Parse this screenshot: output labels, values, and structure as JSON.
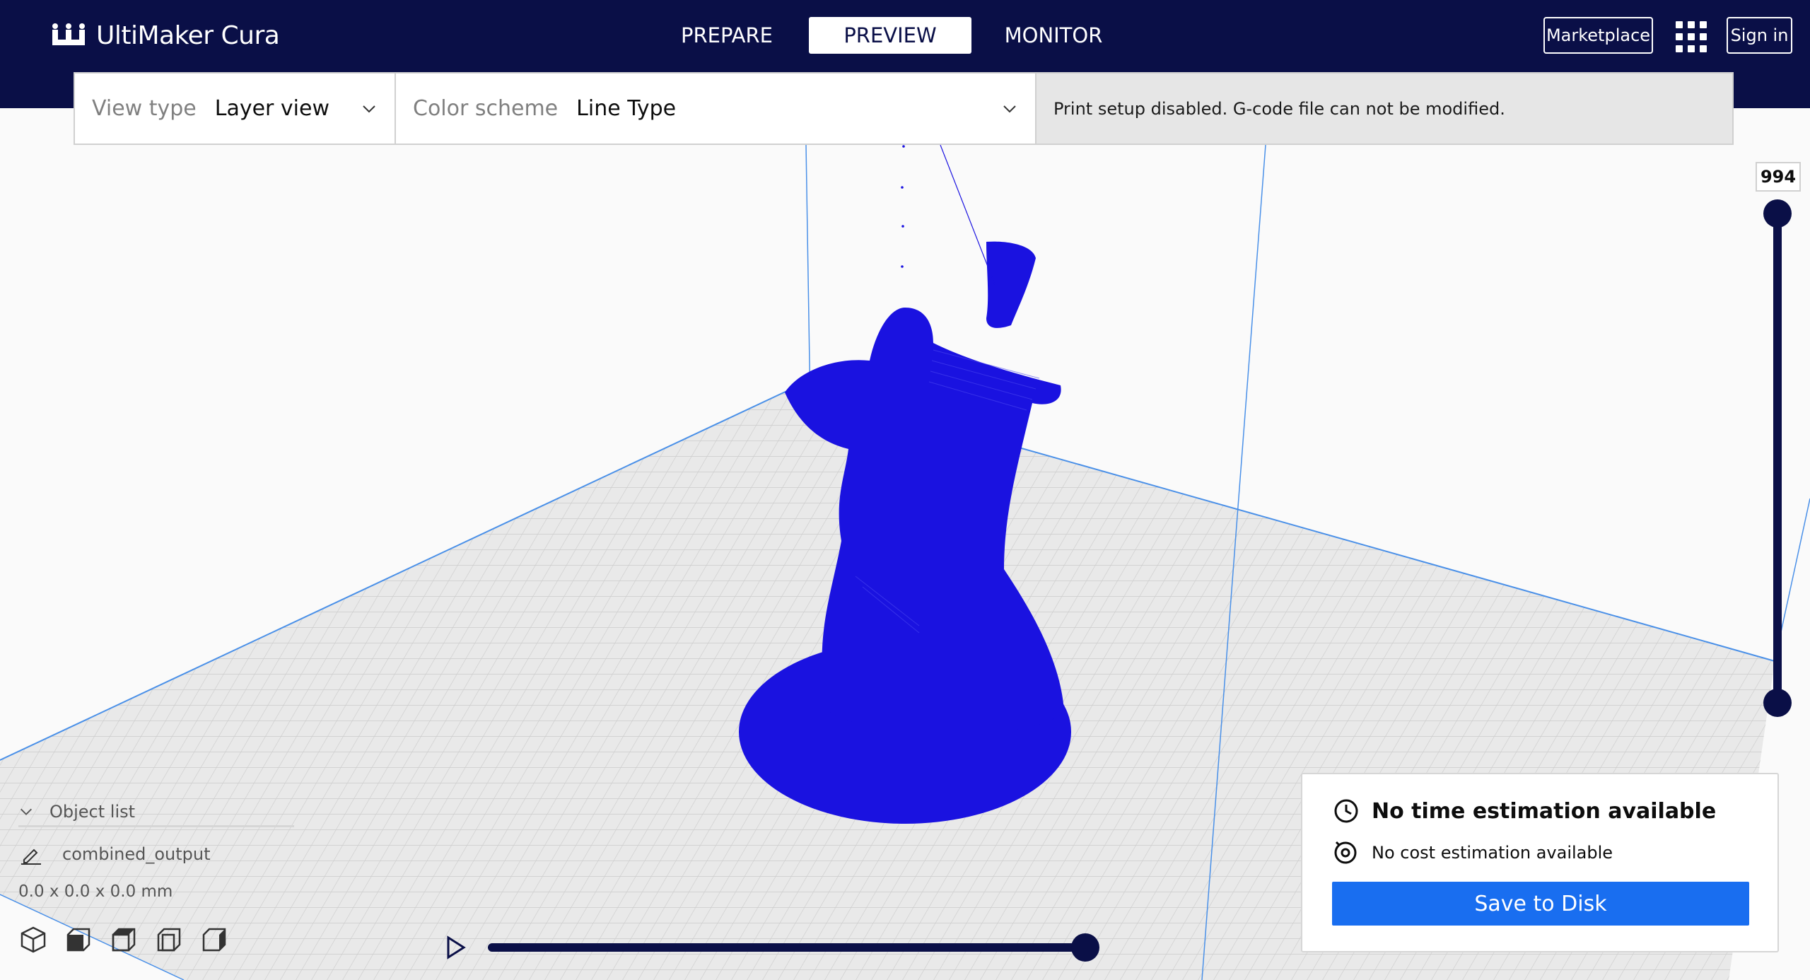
{
  "header": {
    "logo_text": "UltiMaker Cura",
    "tabs": [
      {
        "label": "PREPARE",
        "active": false
      },
      {
        "label": "PREVIEW",
        "active": true
      },
      {
        "label": "MONITOR",
        "active": false
      }
    ],
    "marketplace_label": "Marketplace",
    "signin_label": "Sign in"
  },
  "view_settings": {
    "view_type_label": "View type",
    "view_type_value": "Layer view",
    "color_scheme_label": "Color scheme",
    "color_scheme_value": "Line Type",
    "message": "Print setup disabled. G-code file can not be modified."
  },
  "layer_slider": {
    "value": "994"
  },
  "object_list": {
    "title": "Object list",
    "items": [
      {
        "name": "combined_output"
      }
    ],
    "dimensions": "0.0 x 0.0 x 0.0 mm"
  },
  "estimation": {
    "time_text": "No time estimation available",
    "cost_text": "No cost estimation available",
    "save_label": "Save to Disk"
  },
  "colors": {
    "header_bg": "#0a0f47",
    "model_blue": "#1a12e0",
    "accent_blue": "#196ef0",
    "build_plate": "#e9e9e9"
  },
  "icons": [
    "ultimaker-logo-icon",
    "chevron-down-icon",
    "apps-grid-icon",
    "edit-pencil-icon",
    "clock-icon",
    "cost-icon",
    "play-icon",
    "view-3d-icon",
    "view-front-icon",
    "view-top-icon",
    "view-left-icon",
    "view-right-icon"
  ]
}
